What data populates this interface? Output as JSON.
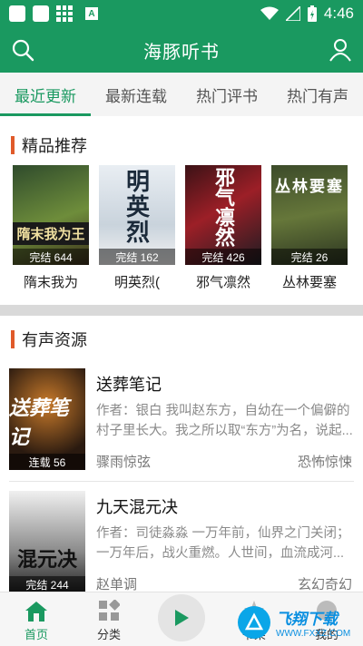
{
  "status_bar": {
    "time": "4:46"
  },
  "app_bar": {
    "title": "海豚听书"
  },
  "tabs": [
    {
      "label": "最近更新",
      "active": true
    },
    {
      "label": "最新连载",
      "active": false
    },
    {
      "label": "热门评书",
      "active": false
    },
    {
      "label": "热门有声",
      "active": false
    }
  ],
  "featured": {
    "heading": "精品推荐",
    "books": [
      {
        "name": "隋末我为",
        "status": "完结 644",
        "cover_text": "隋末我为王"
      },
      {
        "name": "明英烈(",
        "status": "完结 162",
        "cover_text": "明英烈"
      },
      {
        "name": "邪气凛然",
        "status": "完结 426",
        "cover_text": "邪气凛然"
      },
      {
        "name": "丛林要塞",
        "status": "完结 26",
        "cover_text": "丛林要塞"
      }
    ]
  },
  "audio": {
    "heading": "有声资源",
    "items": [
      {
        "title": "送葬笔记",
        "desc": "作者：银白 我叫赵东方，自幼在一个偏僻的村子里长大。我之所以取“东方”为名，说起...",
        "author": "骤雨惊弦",
        "genre": "恐怖惊悚",
        "status": "连载 56",
        "cover_text": "送葬笔记"
      },
      {
        "title": "九天混元决",
        "desc": "作者：司徒淼淼 一万年前，仙界之门关闭；一万年后，战火重燃。人世间，血流成河...",
        "author": "赵单调",
        "genre": "玄幻奇幻",
        "status": "完结 244",
        "cover_text": "混元决"
      }
    ]
  },
  "bottom_nav": {
    "home": "首页",
    "category": "分类",
    "play_icon": "play-icon",
    "history": "书架",
    "profile": "我的"
  },
  "watermark": {
    "main": "飞翔下载",
    "sub": "WWW.FXXZ.COM"
  },
  "colors": {
    "primary": "#1a9960",
    "accent": "#e05a2a"
  }
}
